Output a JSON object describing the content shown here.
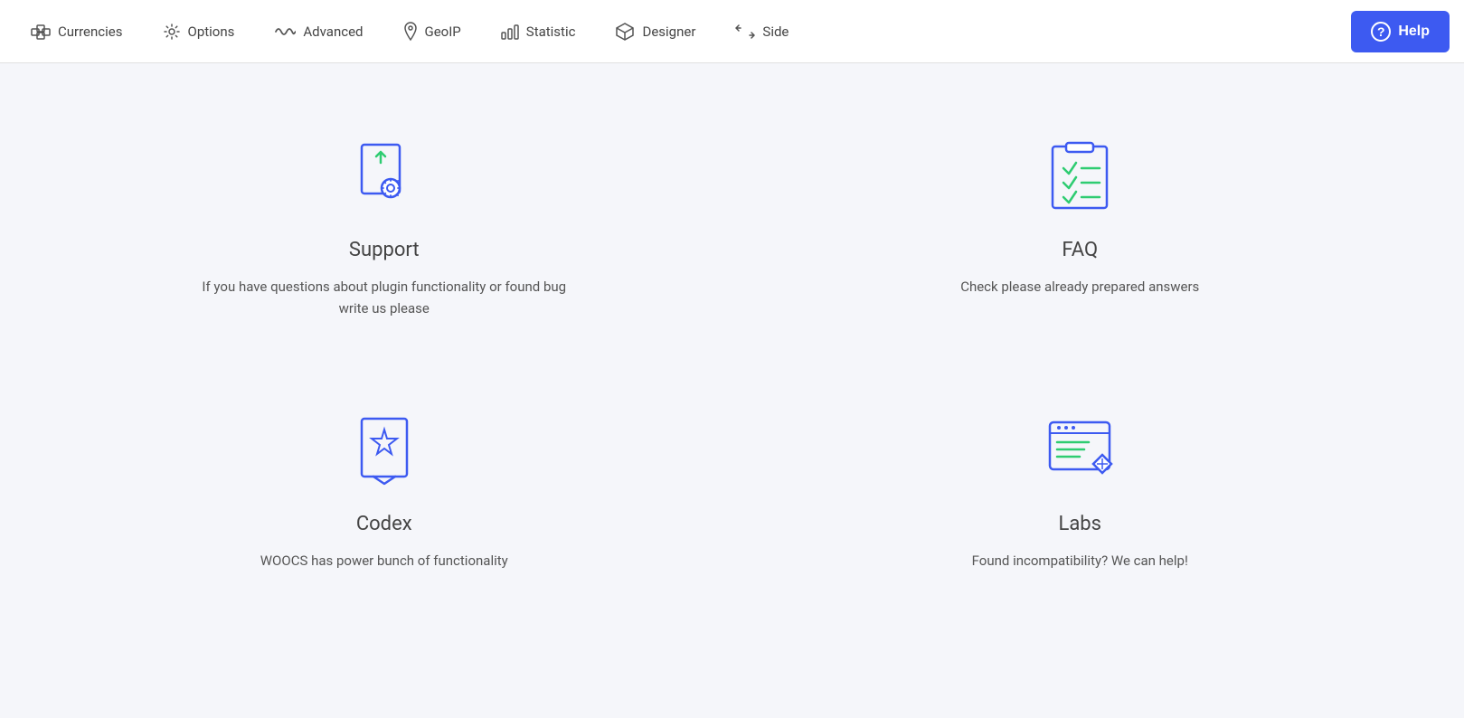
{
  "nav": {
    "items": [
      {
        "id": "currencies",
        "label": "Currencies",
        "icon": "cubes"
      },
      {
        "id": "options",
        "label": "Options",
        "icon": "gear"
      },
      {
        "id": "advanced",
        "label": "Advanced",
        "icon": "wave"
      },
      {
        "id": "geoip",
        "label": "GeoIP",
        "icon": "pin"
      },
      {
        "id": "statistic",
        "label": "Statistic",
        "icon": "bars"
      },
      {
        "id": "designer",
        "label": "Designer",
        "icon": "box"
      },
      {
        "id": "side",
        "label": "Side",
        "icon": "arrows"
      }
    ],
    "help_label": "Help"
  },
  "cards": [
    {
      "id": "support",
      "title": "Support",
      "desc": "If you have questions about plugin functionality or found bug write us please"
    },
    {
      "id": "faq",
      "title": "FAQ",
      "desc": "Check please already prepared answers"
    },
    {
      "id": "codex",
      "title": "Codex",
      "desc": "WOOCS has power bunch of functionality"
    },
    {
      "id": "labs",
      "title": "Labs",
      "desc": "Found incompatibility? We can help!"
    }
  ]
}
